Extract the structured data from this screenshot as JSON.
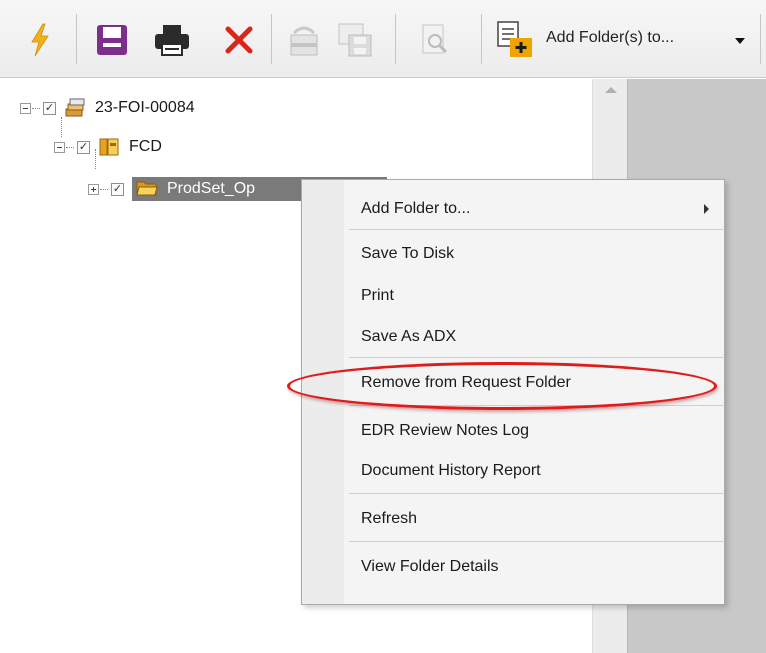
{
  "toolbar": {
    "buttons": [
      {
        "icon": "lightning-icon",
        "color": "#f2b01e"
      },
      {
        "icon": "save-icon",
        "color": "#7b2e8c"
      },
      {
        "icon": "print-icon",
        "color": "#2b2b2b"
      },
      {
        "icon": "delete-icon",
        "color": "#d9261c"
      },
      {
        "icon": "remove-folder-icon",
        "color": "#c7c7c7"
      },
      {
        "icon": "save-disk-icon",
        "color": "#c7c7c7"
      },
      {
        "icon": "search-document-icon",
        "color": "#c7c7c7"
      },
      {
        "icon": "add-folder-icon",
        "color": "#f0a400"
      }
    ],
    "add_folder_label": "Add Folder(s) to...",
    "dropdown_icon": "dropdown-arrow-icon"
  },
  "tree": {
    "nodes": [
      {
        "label": "23-FOI-00084",
        "icon": "request-stack-icon",
        "checked": true,
        "expanded": true
      },
      {
        "label": "FCD",
        "icon": "folder-group-icon",
        "checked": true,
        "expanded": true
      },
      {
        "label": "ProdSet_Op",
        "icon": "folder-icon",
        "checked": true,
        "expanded": false,
        "selected": true
      }
    ]
  },
  "context_menu": {
    "items": [
      {
        "label": "Add Folder to...",
        "has_submenu": true
      },
      {
        "label": "Save To Disk"
      },
      {
        "label": "Print"
      },
      {
        "label": "Save As ADX"
      },
      {
        "label": "Remove from Request Folder",
        "highlighted": true
      },
      {
        "label": "EDR Review Notes Log"
      },
      {
        "label": "Document History Report"
      },
      {
        "label": "Refresh"
      },
      {
        "label": "View Folder Details"
      }
    ],
    "highlight_color": "#e01b1b"
  },
  "colors": {
    "selected_node_bg": "#7a7a7a",
    "right_pane_bg": "#c8c8c8",
    "menu_bg": "#f4f4f4"
  }
}
